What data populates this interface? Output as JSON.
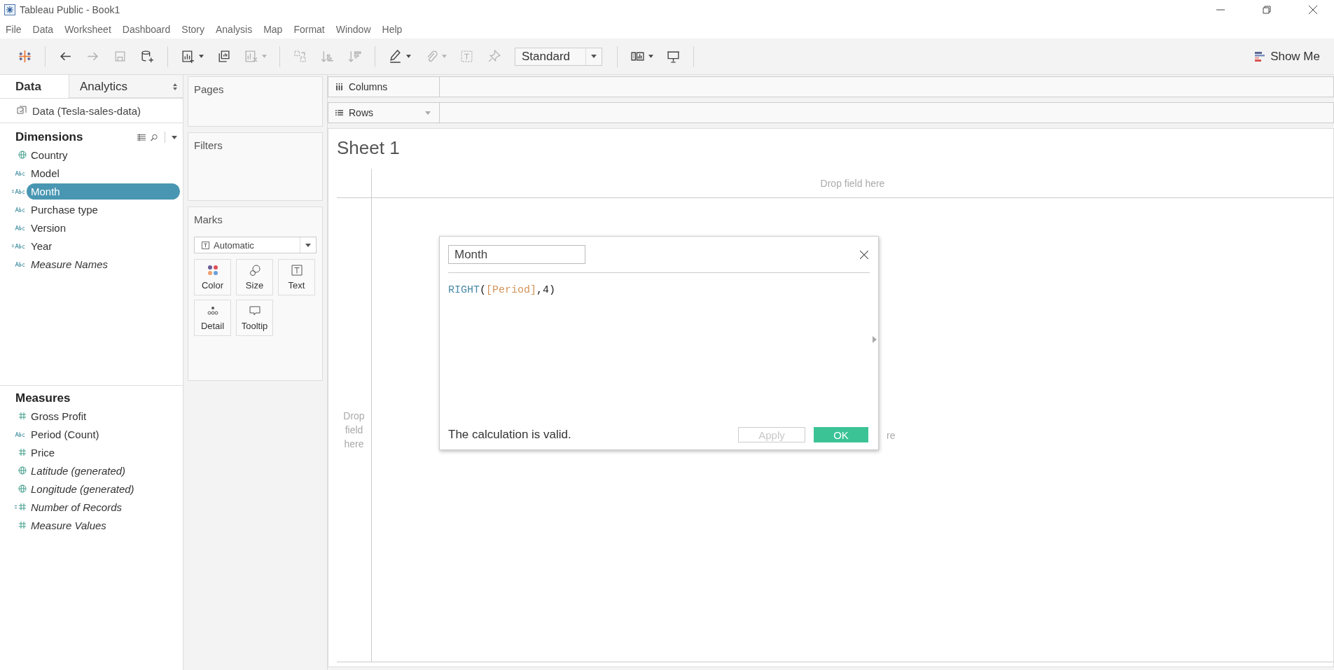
{
  "window": {
    "title": "Tableau Public - Book1"
  },
  "menu": [
    "File",
    "Data",
    "Worksheet",
    "Dashboard",
    "Story",
    "Analysis",
    "Map",
    "Format",
    "Window",
    "Help"
  ],
  "toolbar": [
    {
      "kind": "logo",
      "disabled": false,
      "dropdown": false
    },
    {
      "kind": "divider"
    },
    {
      "kind": "back",
      "disabled": false,
      "dropdown": false
    },
    {
      "kind": "forward",
      "disabled": true,
      "dropdown": false
    },
    {
      "kind": "save",
      "disabled": true,
      "dropdown": false
    },
    {
      "kind": "add-data",
      "disabled": false,
      "dropdown": false
    },
    {
      "kind": "divider"
    },
    {
      "kind": "new-sheet",
      "disabled": false,
      "dropdown": true
    },
    {
      "kind": "duplicate",
      "disabled": false,
      "dropdown": false
    },
    {
      "kind": "clear",
      "disabled": true,
      "dropdown": true
    },
    {
      "kind": "divider"
    },
    {
      "kind": "swap",
      "disabled": true,
      "dropdown": false
    },
    {
      "kind": "sort-asc",
      "disabled": true,
      "dropdown": false
    },
    {
      "kind": "sort-desc",
      "disabled": true,
      "dropdown": false
    },
    {
      "kind": "divider"
    },
    {
      "kind": "highlight",
      "disabled": false,
      "dropdown": true
    },
    {
      "kind": "attach",
      "disabled": true,
      "dropdown": true
    },
    {
      "kind": "label",
      "disabled": true,
      "dropdown": false
    },
    {
      "kind": "pin",
      "disabled": true,
      "dropdown": false
    },
    {
      "kind": "select",
      "value": "Standard"
    },
    {
      "kind": "divider"
    },
    {
      "kind": "cards",
      "disabled": false,
      "dropdown": true
    },
    {
      "kind": "present",
      "disabled": false,
      "dropdown": false
    },
    {
      "kind": "divider"
    }
  ],
  "show_me": "Show Me",
  "data_pane": {
    "tabs": [
      {
        "label": "Data",
        "selected": true
      },
      {
        "label": "Analytics",
        "selected": false
      }
    ],
    "source": "Data (Tesla-sales-data)",
    "dimensions": {
      "title": "Dimensions",
      "fields": [
        {
          "name": "Country",
          "kind": "geo",
          "calculated": false,
          "italic": false,
          "selected": false
        },
        {
          "name": "Model",
          "kind": "text",
          "calculated": false,
          "italic": false,
          "selected": false
        },
        {
          "name": "Month",
          "kind": "text",
          "calculated": true,
          "italic": false,
          "selected": true
        },
        {
          "name": "Purchase type",
          "kind": "text",
          "calculated": false,
          "italic": false,
          "selected": false
        },
        {
          "name": "Version",
          "kind": "text",
          "calculated": false,
          "italic": false,
          "selected": false
        },
        {
          "name": "Year",
          "kind": "text",
          "calculated": true,
          "italic": false,
          "selected": false
        },
        {
          "name": "Measure Names",
          "kind": "text",
          "calculated": false,
          "italic": true,
          "selected": false
        }
      ]
    },
    "measures": {
      "title": "Measures",
      "fields": [
        {
          "name": "Gross Profit",
          "kind": "number",
          "calculated": false,
          "italic": false,
          "selected": false
        },
        {
          "name": "Period (Count)",
          "kind": "text",
          "calculated": false,
          "italic": false,
          "selected": false
        },
        {
          "name": "Price",
          "kind": "number",
          "calculated": false,
          "italic": false,
          "selected": false
        },
        {
          "name": "Latitude (generated)",
          "kind": "geo",
          "calculated": false,
          "italic": true,
          "selected": false
        },
        {
          "name": "Longitude (generated)",
          "kind": "geo",
          "calculated": false,
          "italic": true,
          "selected": false
        },
        {
          "name": "Number of Records",
          "kind": "number",
          "calculated": true,
          "italic": true,
          "selected": false
        },
        {
          "name": "Measure Values",
          "kind": "number",
          "calculated": false,
          "italic": true,
          "selected": false
        }
      ]
    }
  },
  "cards": {
    "pages": "Pages",
    "filters": "Filters",
    "marks": {
      "title": "Marks",
      "mark_type": "Automatic",
      "buttons": [
        {
          "label": "Color",
          "kind": "color"
        },
        {
          "label": "Size",
          "kind": "size"
        },
        {
          "label": "Text",
          "kind": "text"
        },
        {
          "label": "Detail",
          "kind": "detail"
        },
        {
          "label": "Tooltip",
          "kind": "tooltip"
        }
      ]
    }
  },
  "shelves": {
    "columns": "Columns",
    "rows": "Rows"
  },
  "sheet": {
    "title": "Sheet 1",
    "column_drop": "Drop field here",
    "row_drop": "Drop field here",
    "center_drop_visible": "re"
  },
  "dialog": {
    "name": "Month",
    "formula": [
      {
        "text": "RIGHT",
        "kind": "function"
      },
      {
        "text": "(",
        "kind": "plain"
      },
      {
        "text": "[Period]",
        "kind": "field"
      },
      {
        "text": ",4)",
        "kind": "plain"
      }
    ],
    "status": "The calculation is valid.",
    "apply": {
      "label": "Apply",
      "disabled": true
    },
    "ok": "OK"
  }
}
